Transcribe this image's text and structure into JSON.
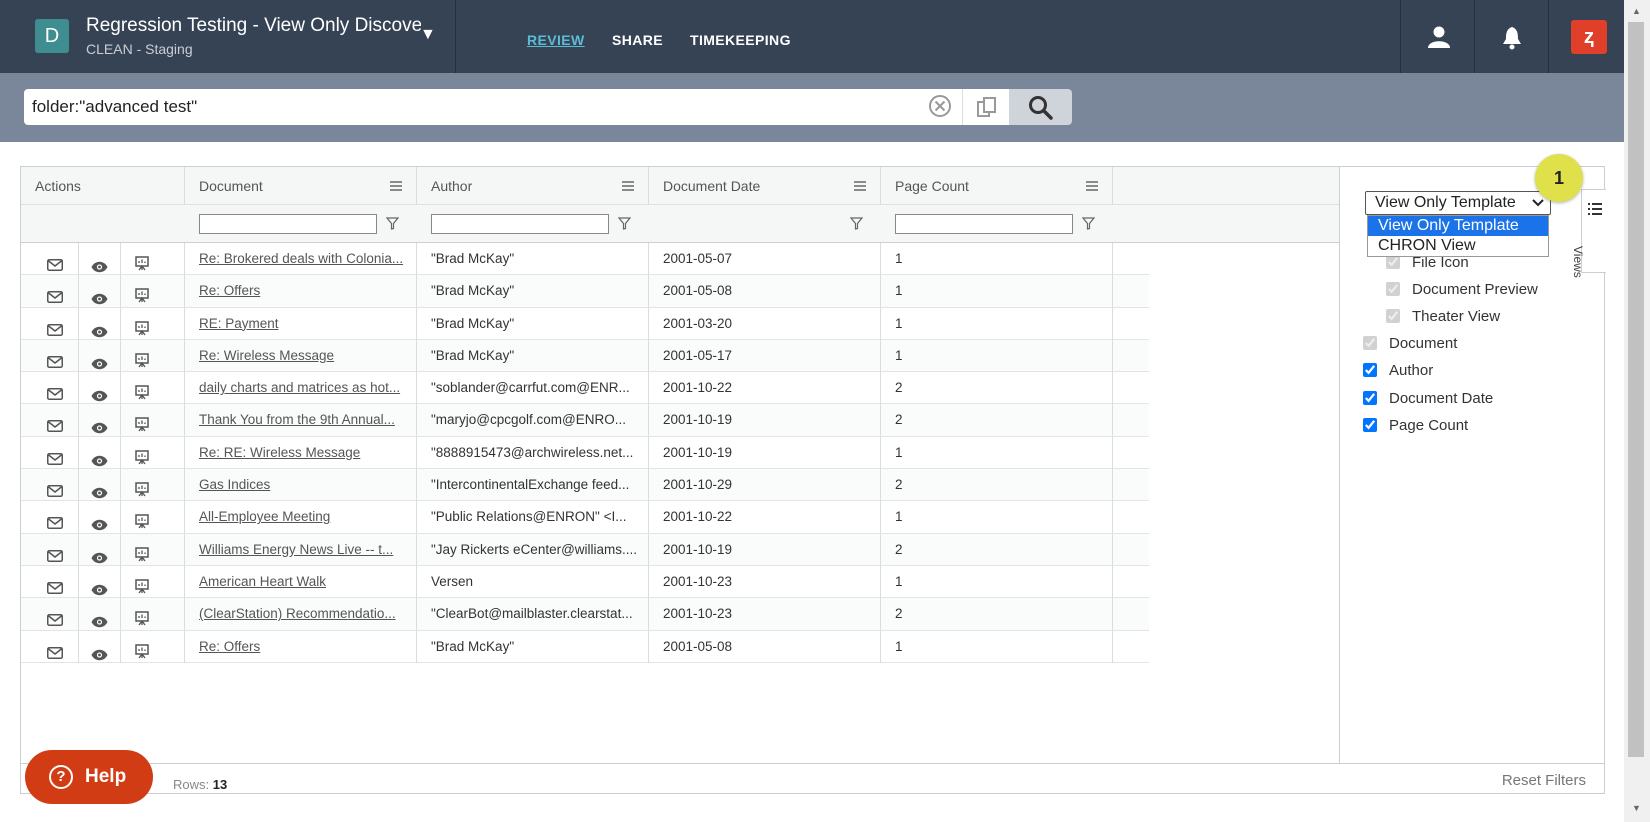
{
  "header": {
    "logo_letter": "D",
    "project_title": "Regression Testing - View Only Discove",
    "project_subtitle": "CLEAN - Staging",
    "nav": [
      {
        "label": "REVIEW",
        "active": true
      },
      {
        "label": "SHARE",
        "active": false
      },
      {
        "label": "TIMEKEEPING",
        "active": false
      }
    ],
    "brand_glyph": "ⱬ"
  },
  "search": {
    "value": "folder:\"advanced test\""
  },
  "grid": {
    "columns": [
      "Actions",
      "Document",
      "Author",
      "Document Date",
      "Page Count"
    ],
    "rows": [
      {
        "document": "Re: Brokered deals with Colonia...",
        "author": "\"Brad McKay\"",
        "date": "2001-05-07",
        "pages": "1"
      },
      {
        "document": "Re: Offers",
        "author": "\"Brad McKay\"",
        "date": "2001-05-08",
        "pages": "1"
      },
      {
        "document": "RE: Payment",
        "author": "\"Brad McKay\"",
        "date": "2001-03-20",
        "pages": "1"
      },
      {
        "document": "Re: Wireless Message",
        "author": "\"Brad McKay\"",
        "date": "2001-05-17",
        "pages": "1"
      },
      {
        "document": "daily charts and matrices as hot...",
        "author": "\"soblander@carrfut.com@ENR...",
        "date": "2001-10-22",
        "pages": "2"
      },
      {
        "document": "Thank You from the 9th Annual...",
        "author": "\"maryjo@cpcgolf.com@ENRO...",
        "date": "2001-10-19",
        "pages": "2"
      },
      {
        "document": "Re: RE: Wireless Message",
        "author": "\"8888915473@archwireless.net...",
        "date": "2001-10-19",
        "pages": "1"
      },
      {
        "document": "Gas Indices",
        "author": "\"IntercontinentalExchange feed...",
        "date": "2001-10-29",
        "pages": "2"
      },
      {
        "document": "All-Employee Meeting",
        "author": "\"Public Relations@ENRON\" <I...",
        "date": "2001-10-22",
        "pages": "1"
      },
      {
        "document": "Williams Energy News Live -- t...",
        "author": "\"Jay Rickerts eCenter@williams....",
        "date": "2001-10-19",
        "pages": "2"
      },
      {
        "document": "American Heart Walk",
        "author": "Versen",
        "date": "2001-10-23",
        "pages": "1"
      },
      {
        "document": "(ClearStation) Recommendatio...",
        "author": "\"ClearBot@mailblaster.clearstat...",
        "date": "2001-10-23",
        "pages": "2"
      },
      {
        "document": "Re: Offers",
        "author": "\"Brad McKay\"",
        "date": "2001-05-08",
        "pages": "1"
      }
    ],
    "rows_label": "Rows:",
    "rows_count": "13",
    "reset_label": "Reset Filters"
  },
  "views_panel": {
    "tab_label": "Views",
    "selected_template": "View Only Template",
    "options": [
      "View Only Template",
      "CHRON View"
    ],
    "columns": [
      {
        "label": "File Icon",
        "checked": true,
        "disabled": true
      },
      {
        "label": "Document Preview",
        "checked": true,
        "disabled": true
      },
      {
        "label": "Theater View",
        "checked": true,
        "disabled": true
      },
      {
        "label": "Document",
        "checked": true,
        "disabled": true
      },
      {
        "label": "Author",
        "checked": true,
        "disabled": false
      },
      {
        "label": "Document Date",
        "checked": true,
        "disabled": false
      },
      {
        "label": "Page Count",
        "checked": true,
        "disabled": false
      }
    ]
  },
  "badge": "1",
  "help_label": "Help",
  "help_glyph": "?"
}
